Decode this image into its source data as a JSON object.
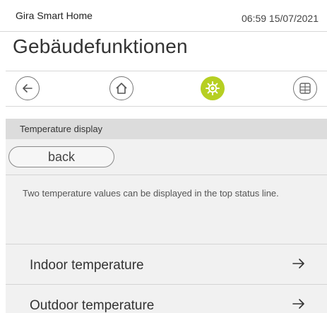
{
  "header": {
    "app_name": "Gira Smart Home",
    "datetime": "06:59 15/07/2021"
  },
  "page_title": "Gebäudefunktionen",
  "nav": {
    "items": [
      {
        "icon": "back-arrow-icon",
        "active": false
      },
      {
        "icon": "home-icon",
        "active": false
      },
      {
        "icon": "gear-icon",
        "active": true
      },
      {
        "icon": "grid-icon",
        "active": false
      }
    ],
    "active_color": "#b6cf22"
  },
  "section": {
    "heading": "Temperature display",
    "back_label": "back",
    "description": "Two temperature values can be displayed in the top status line."
  },
  "menu": [
    {
      "label": "Indoor temperature",
      "icon": "arrow-right-icon"
    },
    {
      "label": "Outdoor temperature",
      "icon": "arrow-right-icon"
    }
  ]
}
